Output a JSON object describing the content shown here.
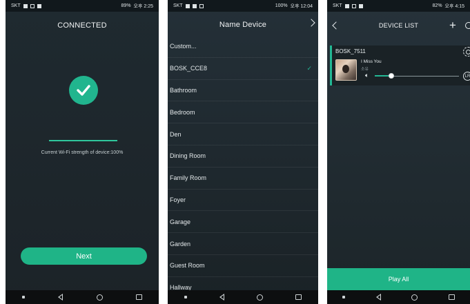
{
  "status_bars": [
    {
      "carrier": "SKT",
      "battery": "89%",
      "time": "오후 2:25"
    },
    {
      "carrier": "SKT",
      "battery": "100%",
      "time": "오후 12:04"
    },
    {
      "carrier": "SKT",
      "battery": "82%",
      "time": "오후 4:15"
    }
  ],
  "connected": {
    "title": "CONNECTED",
    "status_icon": "checkmark-circle-icon",
    "wifi_text": "Current Wi-Fi strength of device:100%",
    "wifi_strength_percent": 100,
    "next_label": "Next",
    "accent": "#1fb487"
  },
  "name_device": {
    "title": "Name Device",
    "selected": "BOSK_CCE8",
    "items": [
      {
        "label": "Custom...",
        "checked": false
      },
      {
        "label": "BOSK_CCE8",
        "checked": true
      },
      {
        "label": "Bathroom",
        "checked": false
      },
      {
        "label": "Bedroom",
        "checked": false
      },
      {
        "label": "Den",
        "checked": false
      },
      {
        "label": "Dining Room",
        "checked": false
      },
      {
        "label": "Family Room",
        "checked": false
      },
      {
        "label": "Foyer",
        "checked": false
      },
      {
        "label": "Garage",
        "checked": false
      },
      {
        "label": "Garden",
        "checked": false
      },
      {
        "label": "Guest Room",
        "checked": false
      },
      {
        "label": "Hallway",
        "checked": false
      }
    ],
    "tick_glyph": "✓"
  },
  "device_list": {
    "title": "DEVICE LIST",
    "plus_glyph": "+",
    "device": {
      "name": "BOSK_7511",
      "song": "I Miss You",
      "artist": "소유",
      "volume_level": 0.2,
      "lr_label": "LR"
    },
    "play_all_label": "Play All"
  }
}
